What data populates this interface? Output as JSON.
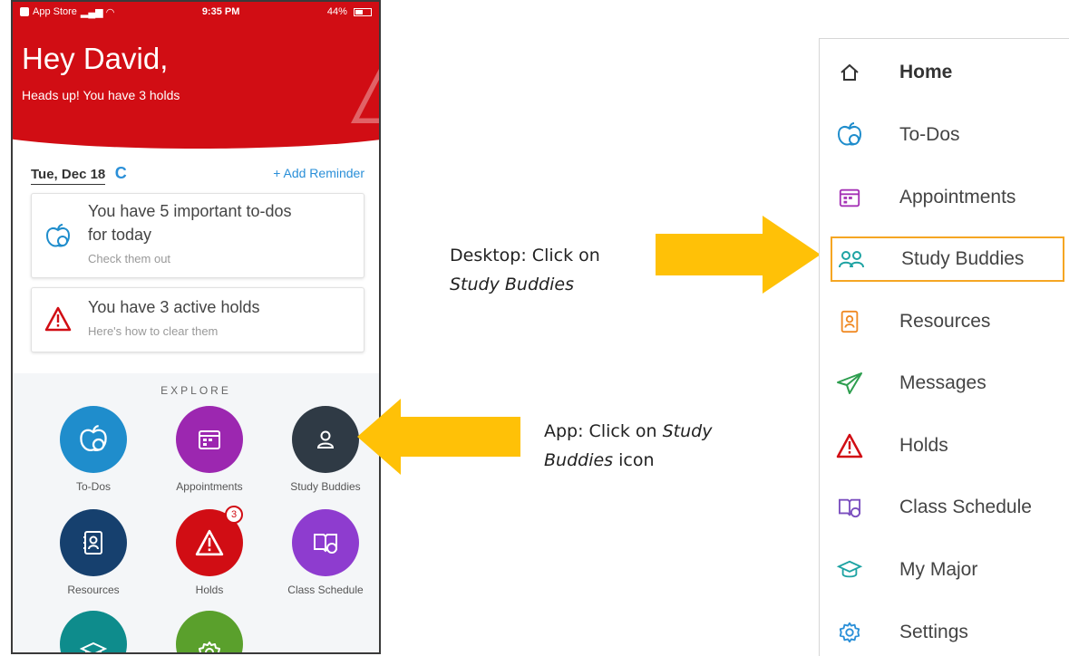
{
  "status_bar": {
    "carrier": "App Store",
    "time": "9:35 PM",
    "battery": "44%"
  },
  "header": {
    "greeting": "Hey David,",
    "subtitle": "Heads up! You have 3 holds"
  },
  "date_row": {
    "date": "Tue, Dec 18",
    "refresh_icon": "C",
    "add_reminder": "+ Add Reminder"
  },
  "cards": [
    {
      "title": "You have 5 important to-dos for today",
      "title_line1": "You have 5 important to-dos",
      "title_line2": "for today",
      "subtitle": "Check them out",
      "icon": "apple-icon"
    },
    {
      "title": "You have 3 active holds",
      "subtitle": "Here's how to clear them",
      "icon": "warning-icon"
    }
  ],
  "explore": {
    "label": "EXPLORE",
    "tiles": [
      {
        "label": "To-Dos",
        "color": "#1f8dcc",
        "icon": "apple-icon"
      },
      {
        "label": "Appointments",
        "color": "#9c27b0",
        "icon": "calendar-icon"
      },
      {
        "label": "Study Buddies",
        "color": "#2f3a45",
        "icon": "person-icon"
      },
      {
        "label": "Resources",
        "color": "#16406e",
        "icon": "address-book-icon"
      },
      {
        "label": "Holds",
        "color": "#d10d14",
        "icon": "warning-icon",
        "badge": "3"
      },
      {
        "label": "Class Schedule",
        "color": "#8e3ccf",
        "icon": "book-icon"
      },
      {
        "label": "",
        "color": "#0e8c8c",
        "icon": "graduation-cap-icon"
      },
      {
        "label": "",
        "color": "#5aa02c",
        "icon": "gear-icon"
      }
    ]
  },
  "annotations": {
    "desktop_line1": "Desktop: Click on",
    "desktop_line2": "Study Buddies",
    "app_prefix": "App: Click on ",
    "app_italic1": "Study",
    "app_italic2": "Buddies",
    "app_suffix": " icon",
    "arrow_color": "#ffc107"
  },
  "sidebar": {
    "items": [
      {
        "label": "Home",
        "icon": "home-icon",
        "bold": true
      },
      {
        "label": "To-Dos",
        "icon": "apple-icon"
      },
      {
        "label": "Appointments",
        "icon": "calendar-icon"
      },
      {
        "label": "Study Buddies",
        "icon": "people-icon",
        "highlighted": true
      },
      {
        "label": "Resources",
        "icon": "address-book-icon"
      },
      {
        "label": "Messages",
        "icon": "paper-plane-icon"
      },
      {
        "label": "Holds",
        "icon": "warning-icon"
      },
      {
        "label": "Class Schedule",
        "icon": "book-icon"
      },
      {
        "label": "My Major",
        "icon": "graduation-cap-icon"
      },
      {
        "label": "Settings",
        "icon": "gear-icon"
      }
    ],
    "highlight_color": "#f5a623"
  }
}
